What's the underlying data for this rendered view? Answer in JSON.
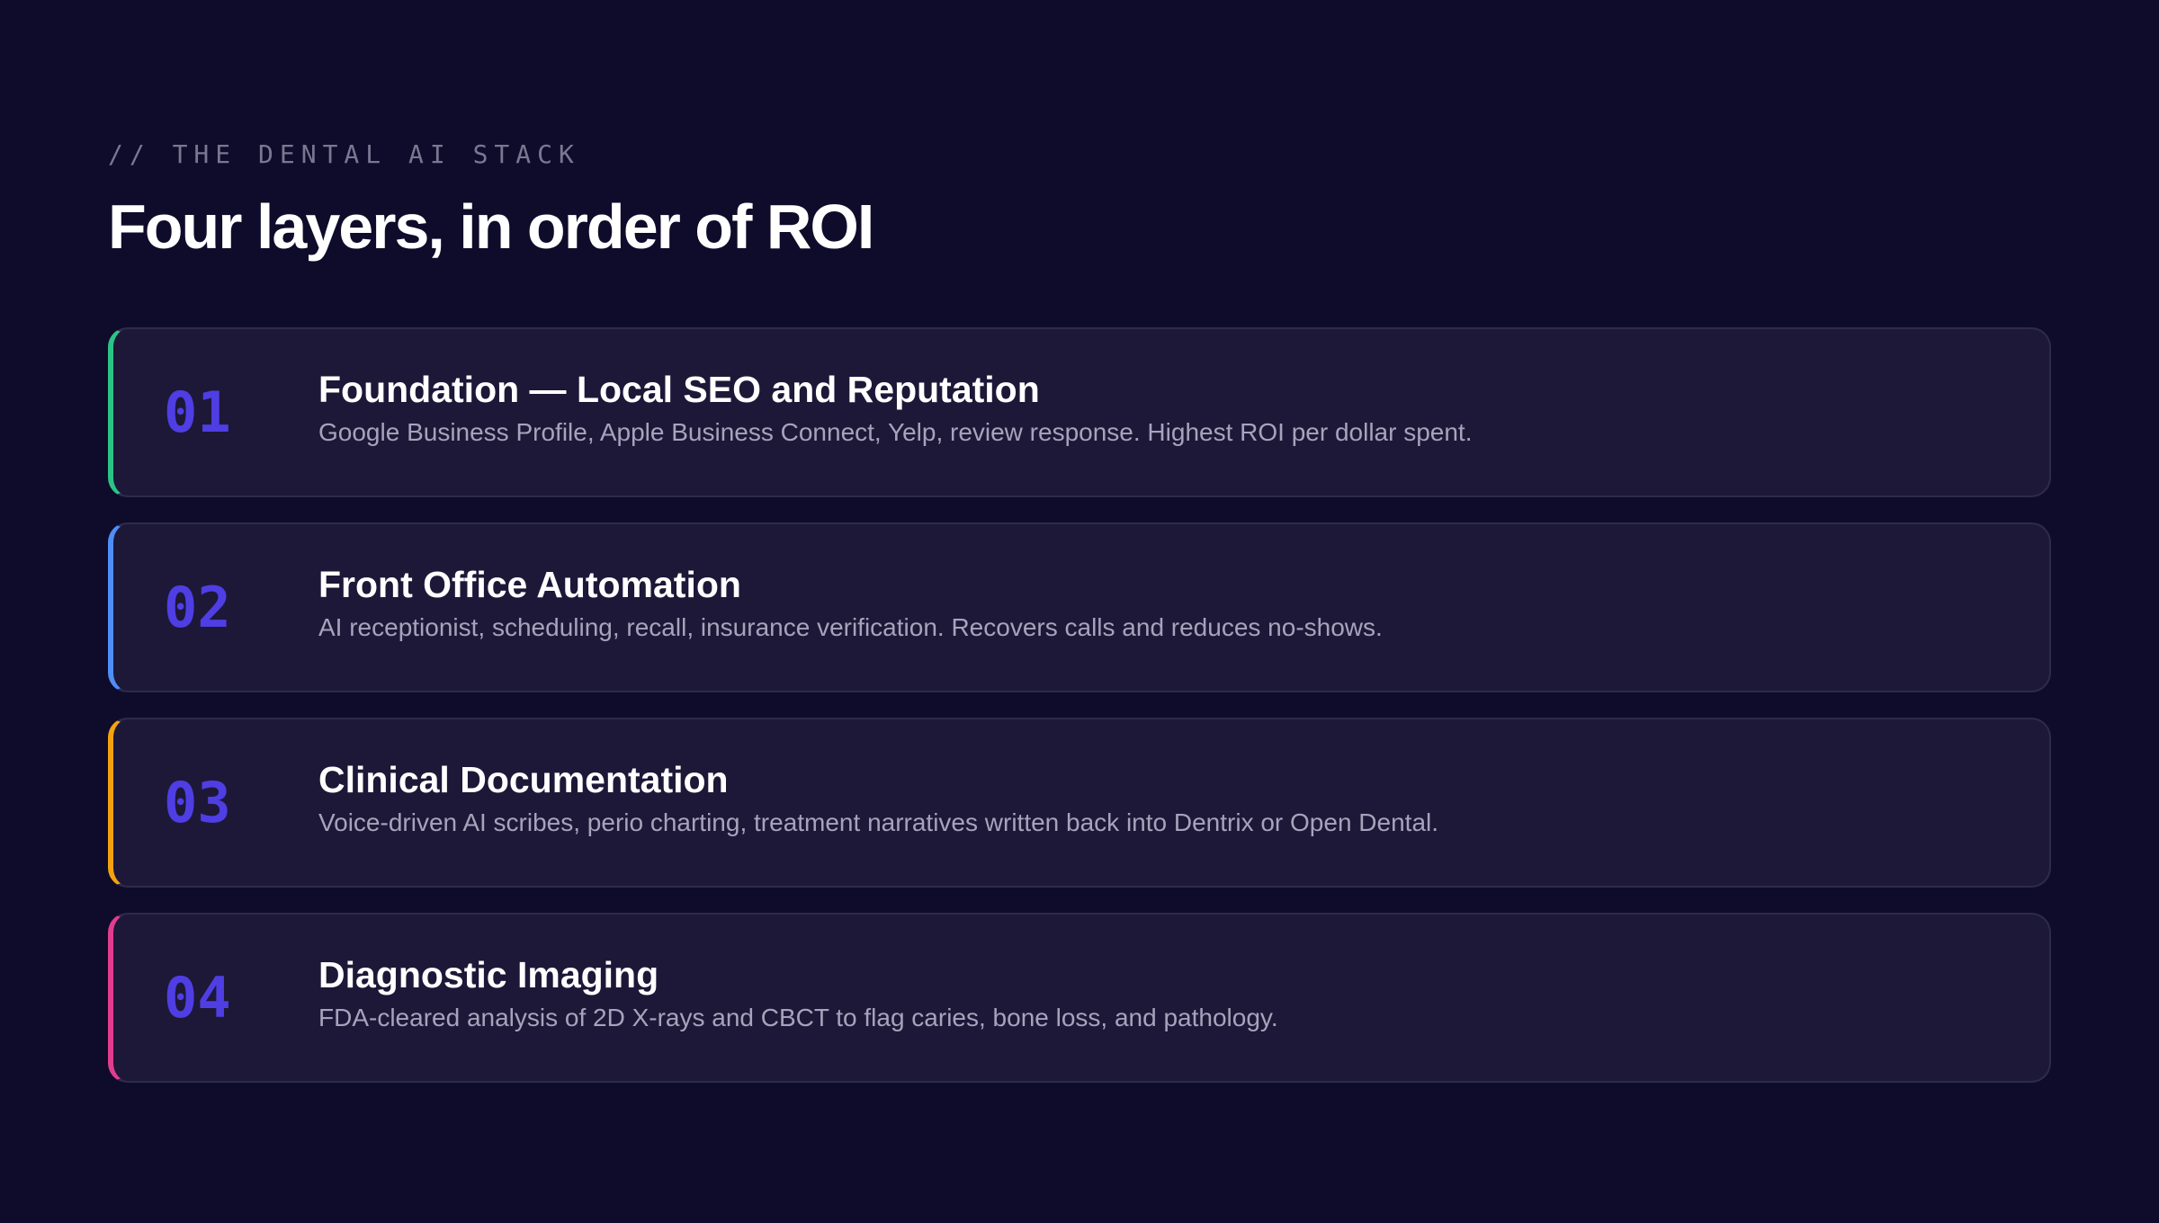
{
  "header": {
    "eyebrow": "// THE DENTAL AI STACK",
    "title": "Four layers, in order of ROI"
  },
  "layers": [
    {
      "number": "01",
      "title": "Foundation — Local SEO and Reputation",
      "description": "Google Business Profile, Apple Business Connect, Yelp, review response. Highest ROI per dollar spent.",
      "accent_color": "#2bc486"
    },
    {
      "number": "02",
      "title": "Front Office Automation",
      "description": "AI receptionist, scheduling, recall, insurance verification. Recovers calls and reduces no-shows.",
      "accent_color": "#4f8ef7"
    },
    {
      "number": "03",
      "title": "Clinical Documentation",
      "description": "Voice-driven AI scribes, perio charting, treatment narratives written back into Dentrix or Open Dental.",
      "accent_color": "#f4a30f"
    },
    {
      "number": "04",
      "title": "Diagnostic Imaging",
      "description": "FDA-cleared analysis of 2D X-rays and CBCT to flag caries, bone loss, and pathology.",
      "accent_color": "#e13d8e"
    }
  ],
  "colors": {
    "background": "#0f0b2a",
    "card": "#1d1838",
    "number": "#4f3ee3"
  }
}
